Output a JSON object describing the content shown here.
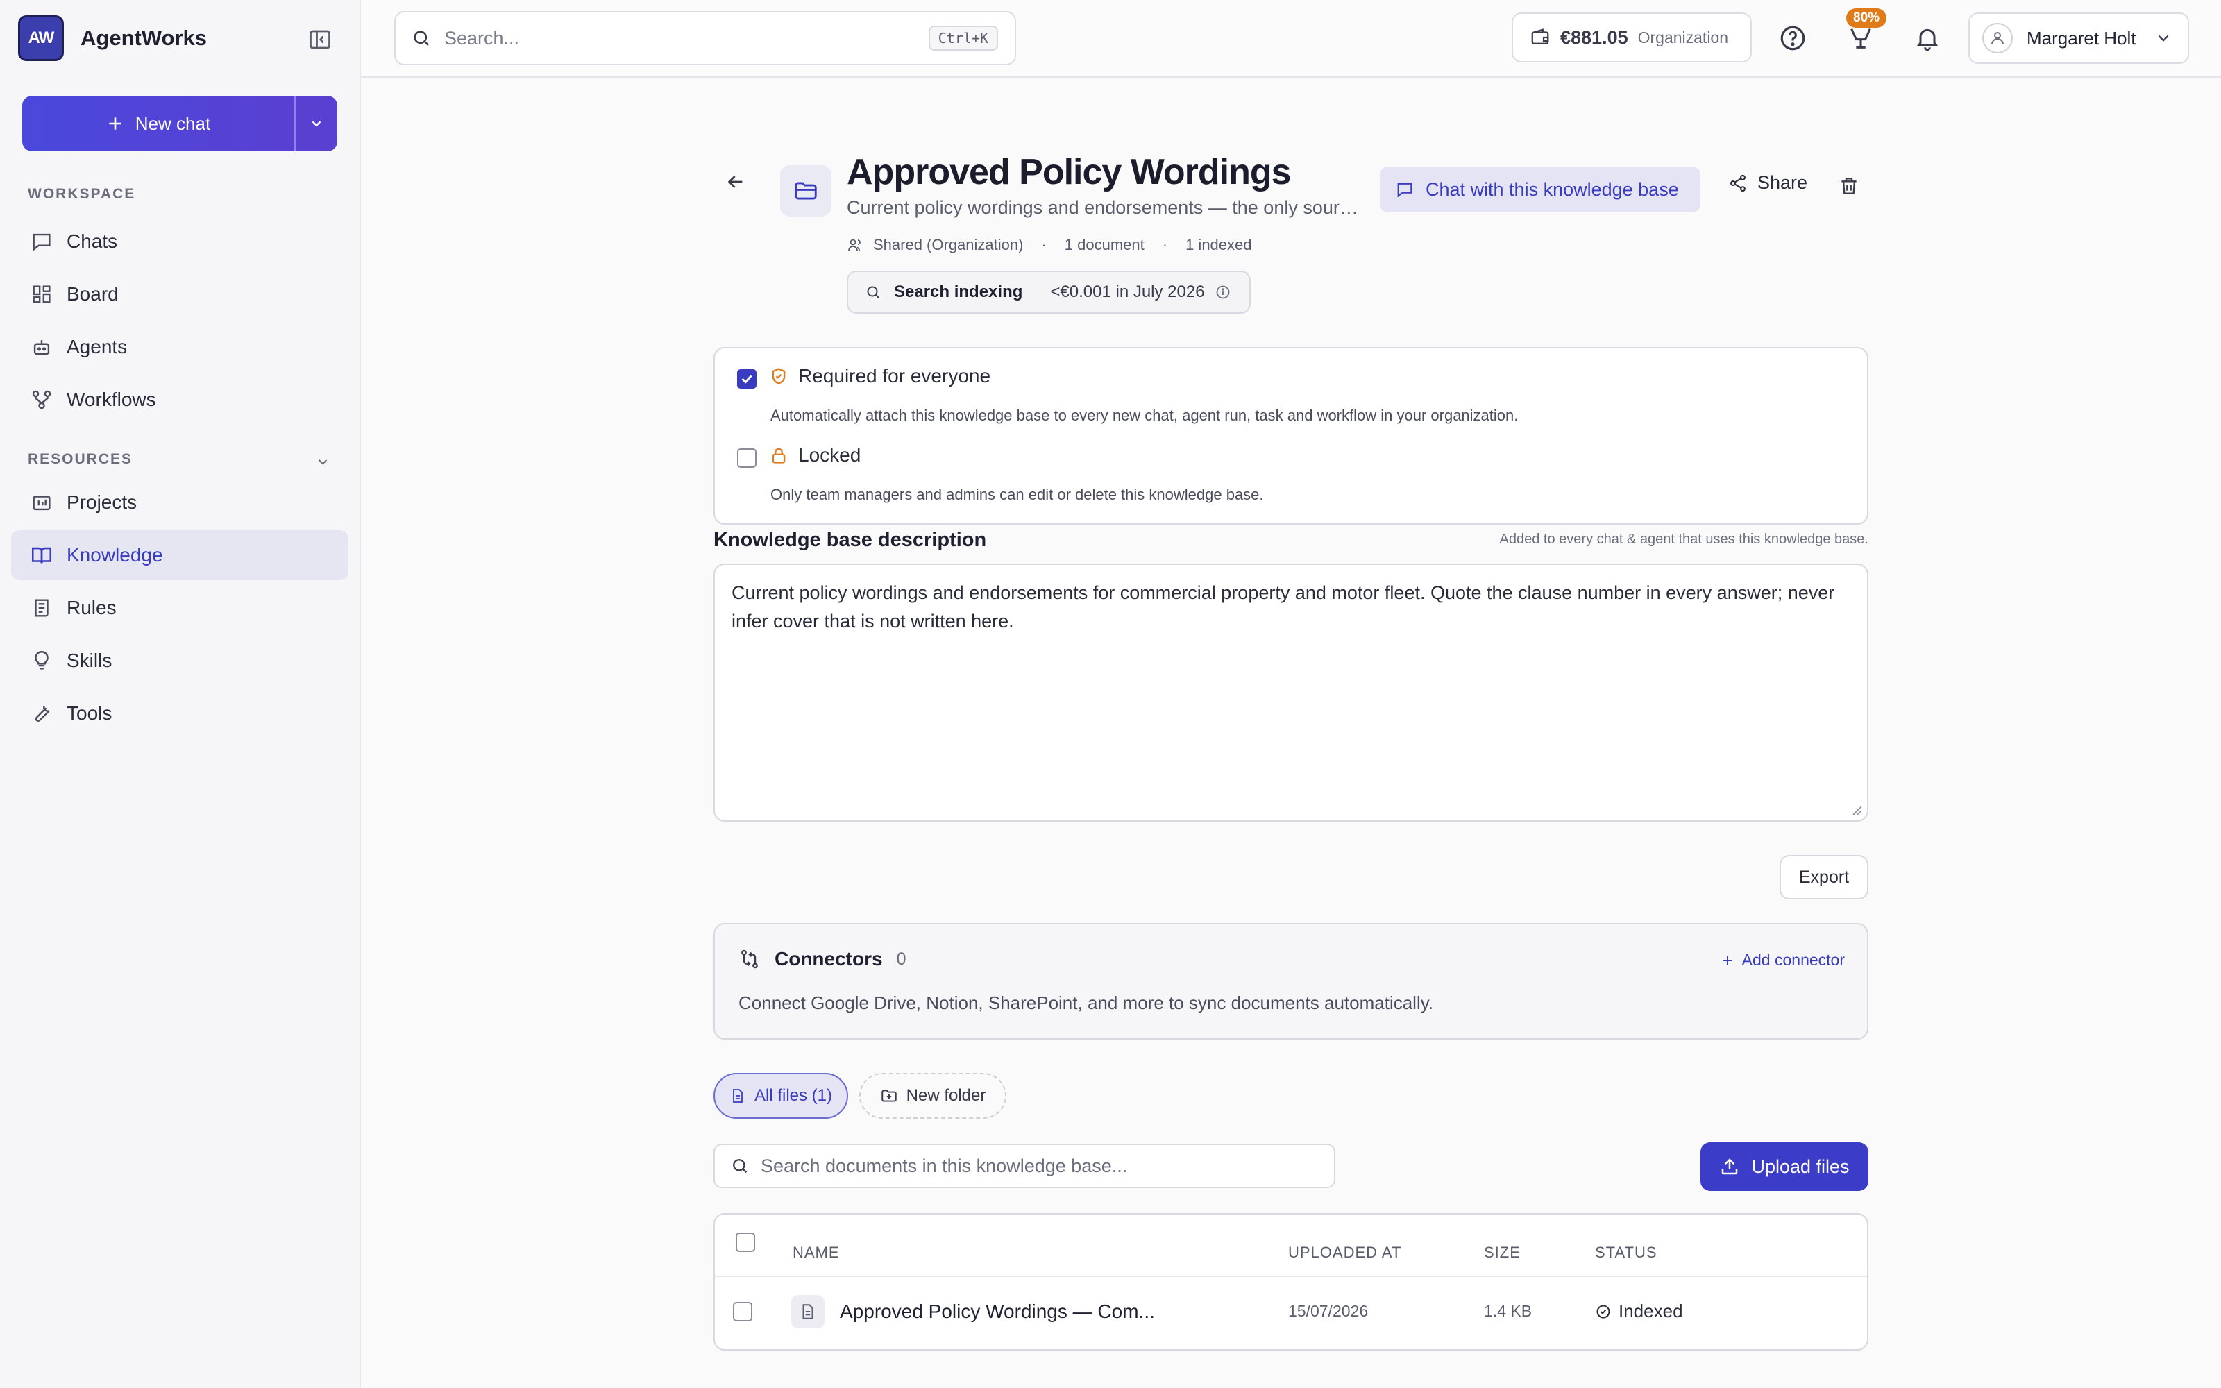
{
  "app": {
    "logo": "AW",
    "name": "AgentWorks"
  },
  "sidebar": {
    "new_chat": "New chat",
    "sections": [
      {
        "label": "WORKSPACE"
      },
      {
        "label": "RESOURCES"
      }
    ],
    "workspace_items": [
      {
        "label": "Chats",
        "icon": "chat-icon"
      },
      {
        "label": "Board",
        "icon": "board-icon"
      },
      {
        "label": "Agents",
        "icon": "robot-icon"
      },
      {
        "label": "Workflows",
        "icon": "workflow-icon"
      }
    ],
    "resource_items": [
      {
        "label": "Projects",
        "icon": "projects-icon"
      },
      {
        "label": "Knowledge",
        "icon": "book-icon",
        "active": true
      },
      {
        "label": "Rules",
        "icon": "rules-icon"
      },
      {
        "label": "Skills",
        "icon": "lightbulb-icon"
      },
      {
        "label": "Tools",
        "icon": "wrench-icon"
      }
    ]
  },
  "topbar": {
    "search_placeholder": "Search...",
    "search_shortcut": "Ctrl+K",
    "balance": "€881.05",
    "balance_scope": "Organization",
    "usage_badge": "80%",
    "user_name": "Margaret Holt"
  },
  "kb": {
    "title": "Approved Policy Wordings",
    "subtitle": "Current policy wordings and endorsements — the only source for answers",
    "sharing": "Shared (Organization)",
    "documents": "1 document",
    "indexed": "1 indexed",
    "index_label": "Search indexing",
    "index_cost": "<€0.001 in July 2026",
    "chat_button": "Chat with this knowledge base",
    "share_button": "Share"
  },
  "settings": {
    "required": {
      "label": "Required for everyone",
      "checked": true,
      "description": "Automatically attach this knowledge base to every new chat, agent run, task and workflow in your organization."
    },
    "locked": {
      "label": "Locked",
      "checked": false,
      "description": "Only team managers and admins can edit or delete this knowledge base."
    }
  },
  "description": {
    "label": "Knowledge base description",
    "hint": "Added to every chat & agent that uses this knowledge base.",
    "text": "Current policy wordings and endorsements for commercial property and motor fleet. Quote the clause number in every answer; never infer cover that is not written here."
  },
  "export_button": "Export",
  "connectors": {
    "title": "Connectors",
    "count": "0",
    "add": "Add connector",
    "description": "Connect Google Drive, Notion, SharePoint, and more to sync documents automatically."
  },
  "files": {
    "tab_all": "All files (1)",
    "tab_new_folder": "New folder",
    "search_placeholder": "Search documents in this knowledge base...",
    "upload": "Upload files",
    "columns": [
      "NAME",
      "UPLOADED AT",
      "SIZE",
      "STATUS"
    ],
    "rows": [
      {
        "name": "Approved Policy Wordings — Com...",
        "uploaded": "15/07/2026",
        "size": "1.4 KB",
        "status": "Indexed"
      }
    ]
  },
  "colors": {
    "accent": "#3a3cc0",
    "badge": "#e07b1a",
    "sidebar_bg": "#f6f6f8"
  }
}
